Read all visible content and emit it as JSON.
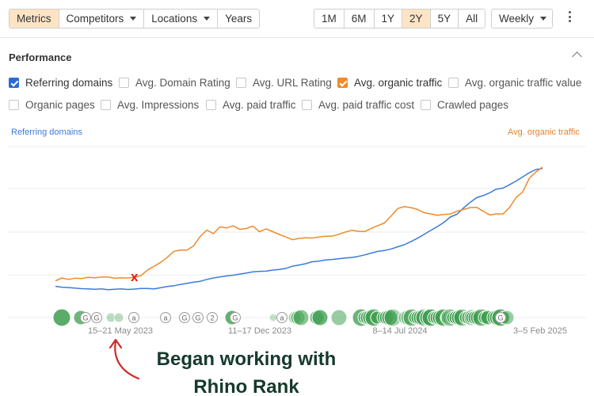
{
  "toolbar": {
    "view_tabs": [
      "Metrics",
      "Competitors",
      "Locations",
      "Years"
    ],
    "active_view": "Metrics",
    "ranges": [
      "1M",
      "6M",
      "1Y",
      "2Y",
      "5Y",
      "All"
    ],
    "active_range": "2Y",
    "granularity": "Weekly"
  },
  "performance": {
    "title": "Performance",
    "metrics": [
      {
        "label": "Referring domains",
        "checked": true,
        "color": "#2c6bd6"
      },
      {
        "label": "Avg. Domain Rating",
        "checked": false
      },
      {
        "label": "Avg. URL Rating",
        "checked": false
      },
      {
        "label": "Avg. organic traffic",
        "checked": true,
        "color": "#f08b2b"
      },
      {
        "label": "Avg. organic traffic value",
        "checked": false
      },
      {
        "label": "Organic pages",
        "checked": false
      },
      {
        "label": "Avg. Impressions",
        "checked": false
      },
      {
        "label": "Avg. paid traffic",
        "checked": false
      },
      {
        "label": "Avg. paid traffic cost",
        "checked": false
      },
      {
        "label": "Crawled pages",
        "checked": false
      }
    ]
  },
  "chart_data": {
    "type": "line",
    "left_axis_label": "Referring domains",
    "right_axis_label": "Avg. organic traffic",
    "x_tick_labels": [
      "15–21 May 2023",
      "11–17 Dec 2023",
      "8–14 Jul 2024",
      "3–5 Feb 2025"
    ],
    "series": [
      {
        "name": "Referring domains",
        "color": "#3b7bd9",
        "values": [
          6,
          5.4,
          5.1,
          4.7,
          4.3,
          4.1,
          3.9,
          4.1,
          3.6,
          3.8,
          4.1,
          3.7,
          4.0,
          4.4,
          4.4,
          4.2,
          5.0,
          5.8,
          6.4,
          7.4,
          8.1,
          9.0,
          9.6,
          11.0,
          12.0,
          12.8,
          13.5,
          14.0,
          14.8,
          15.6,
          16.4,
          16.8,
          16.9,
          17.7,
          18.1,
          18.9,
          20.5,
          21.4,
          22.3,
          23.7,
          24.2,
          25.0,
          25.4,
          25.9,
          26.4,
          26.8,
          27.6,
          28.7,
          30.0,
          31.2,
          31.8,
          33.0,
          34.5,
          36.0,
          38.2,
          40.7,
          43.4,
          46.3,
          49.0,
          52.0,
          56.0,
          58.0,
          62.5,
          66.5,
          70.0,
          71.5,
          73.5,
          76.2,
          76.8,
          79.3,
          82.0,
          85.0,
          88.0,
          90.3,
          91.0
        ]
      },
      {
        "name": "Avg. organic traffic",
        "color": "#f08b2b",
        "values": [
          10,
          12.0,
          11.0,
          11.9,
          11.6,
          12.5,
          12.1,
          12.7,
          12.7,
          11.8,
          12.1,
          12.0,
          12.5,
          13.7,
          17.8,
          20.5,
          23.3,
          27.0,
          31.2,
          32.2,
          32.1,
          35.2,
          42.0,
          46.6,
          44.0,
          48.9,
          48.1,
          49.6,
          47.1,
          47.7,
          49.5,
          45.3,
          47.4,
          45.4,
          43.4,
          41.6,
          39.6,
          40.6,
          41.0,
          40.8,
          41.6,
          42.1,
          42.1,
          43.5,
          45.1,
          46.4,
          45.7,
          45.5,
          47.8,
          49.8,
          51.7,
          56.8,
          62.2,
          63.5,
          62.8,
          61.5,
          59.1,
          58.3,
          57.2,
          57.8,
          58.1,
          60.2,
          61.4,
          62.8,
          63.0,
          60.1,
          57.4,
          58.3,
          58.2,
          62.9,
          70.1,
          74.2,
          84.0,
          88.6,
          92.0
        ]
      }
    ],
    "annotation": {
      "label": "x",
      "color": "#e41b1b",
      "week_index": 12
    },
    "events": {
      "letters": [
        "G",
        "G",
        "G",
        "a",
        "a",
        "G",
        "G",
        "2",
        "G",
        "a",
        "G"
      ],
      "group_density": [
        2,
        1,
        0,
        5,
        3,
        6,
        8,
        7,
        5,
        4
      ]
    }
  },
  "caption": {
    "line1": "Began working with",
    "line2": "Rhino Rank"
  }
}
